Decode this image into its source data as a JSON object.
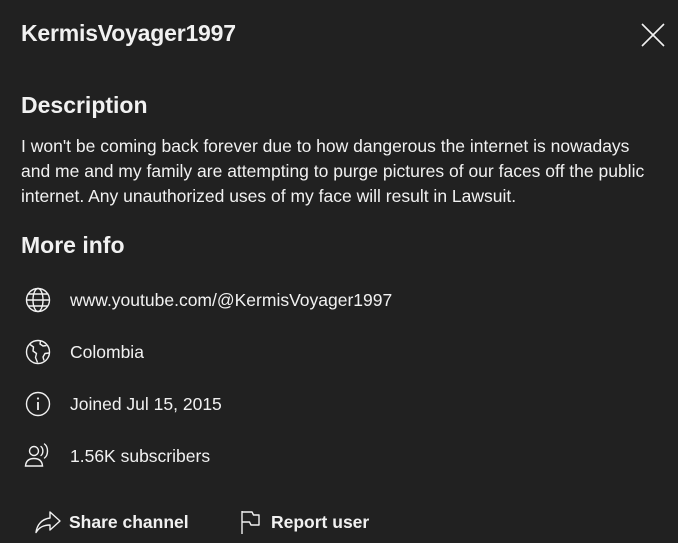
{
  "header": {
    "channel_name": "KermisVoyager1997",
    "close_icon": "close-icon"
  },
  "description": {
    "heading": "Description",
    "text": "I won't be coming back forever due to how dangerous the internet is nowadays and me and my family are attempting to purge pictures of our faces off the public internet. Any unauthorized uses of my face will result in Lawsuit."
  },
  "more_info": {
    "heading": "More info",
    "link": {
      "icon": "globe-icon",
      "text": "www.youtube.com/@KermisVoyager1997"
    },
    "country": {
      "icon": "globe-location-icon",
      "text": "Colombia"
    },
    "joined": {
      "icon": "info-icon",
      "text": "Joined Jul 15, 2015"
    },
    "subscribers": {
      "icon": "subscribers-icon",
      "text": "1.56K subscribers"
    }
  },
  "actions": {
    "share": {
      "icon": "share-icon",
      "label": "Share channel"
    },
    "report": {
      "icon": "flag-icon",
      "label": "Report user"
    }
  },
  "colors": {
    "background": "#212121",
    "text": "#f1f1f1"
  }
}
